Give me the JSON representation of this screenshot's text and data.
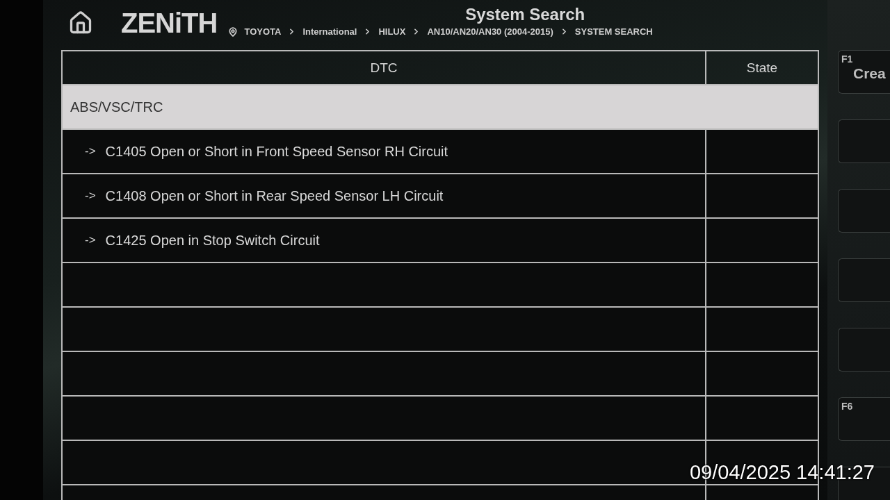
{
  "header": {
    "logo": "ZENiTH",
    "title": "System Search",
    "breadcrumbs": [
      "TOYOTA",
      "International",
      "HILUX",
      "AN10/AN20/AN30 (2004-2015)",
      "SYSTEM SEARCH"
    ]
  },
  "table": {
    "columns": [
      "DTC",
      "State"
    ],
    "rows": [
      {
        "kind": "group",
        "dtc": "ABS/VSC/TRC",
        "selected": true
      },
      {
        "kind": "code",
        "arrow": "->",
        "dtc": "C1405 Open or Short in Front Speed Sensor RH Circuit",
        "selected": false
      },
      {
        "kind": "code",
        "arrow": "->",
        "dtc": "C1408 Open or Short in Rear Speed Sensor LH Circuit",
        "selected": false
      },
      {
        "kind": "code",
        "arrow": "->",
        "dtc": "C1425 Open in Stop Switch Circuit",
        "selected": false
      },
      {
        "kind": "empty",
        "selected": false
      },
      {
        "kind": "empty",
        "selected": false
      },
      {
        "kind": "empty",
        "selected": false
      },
      {
        "kind": "empty",
        "selected": false
      },
      {
        "kind": "empty",
        "selected": false
      },
      {
        "kind": "empty",
        "selected": false
      }
    ]
  },
  "function_keys": [
    {
      "kind": "labelled",
      "key": "F1",
      "label": "Crea"
    },
    {
      "kind": "blank"
    },
    {
      "kind": "blank"
    },
    {
      "kind": "blank"
    },
    {
      "kind": "blank"
    },
    {
      "kind": "labelled",
      "key": "F6"
    },
    {
      "kind": "blank"
    }
  ],
  "photo_timestamp": "09/04/2025 14:41:27"
}
